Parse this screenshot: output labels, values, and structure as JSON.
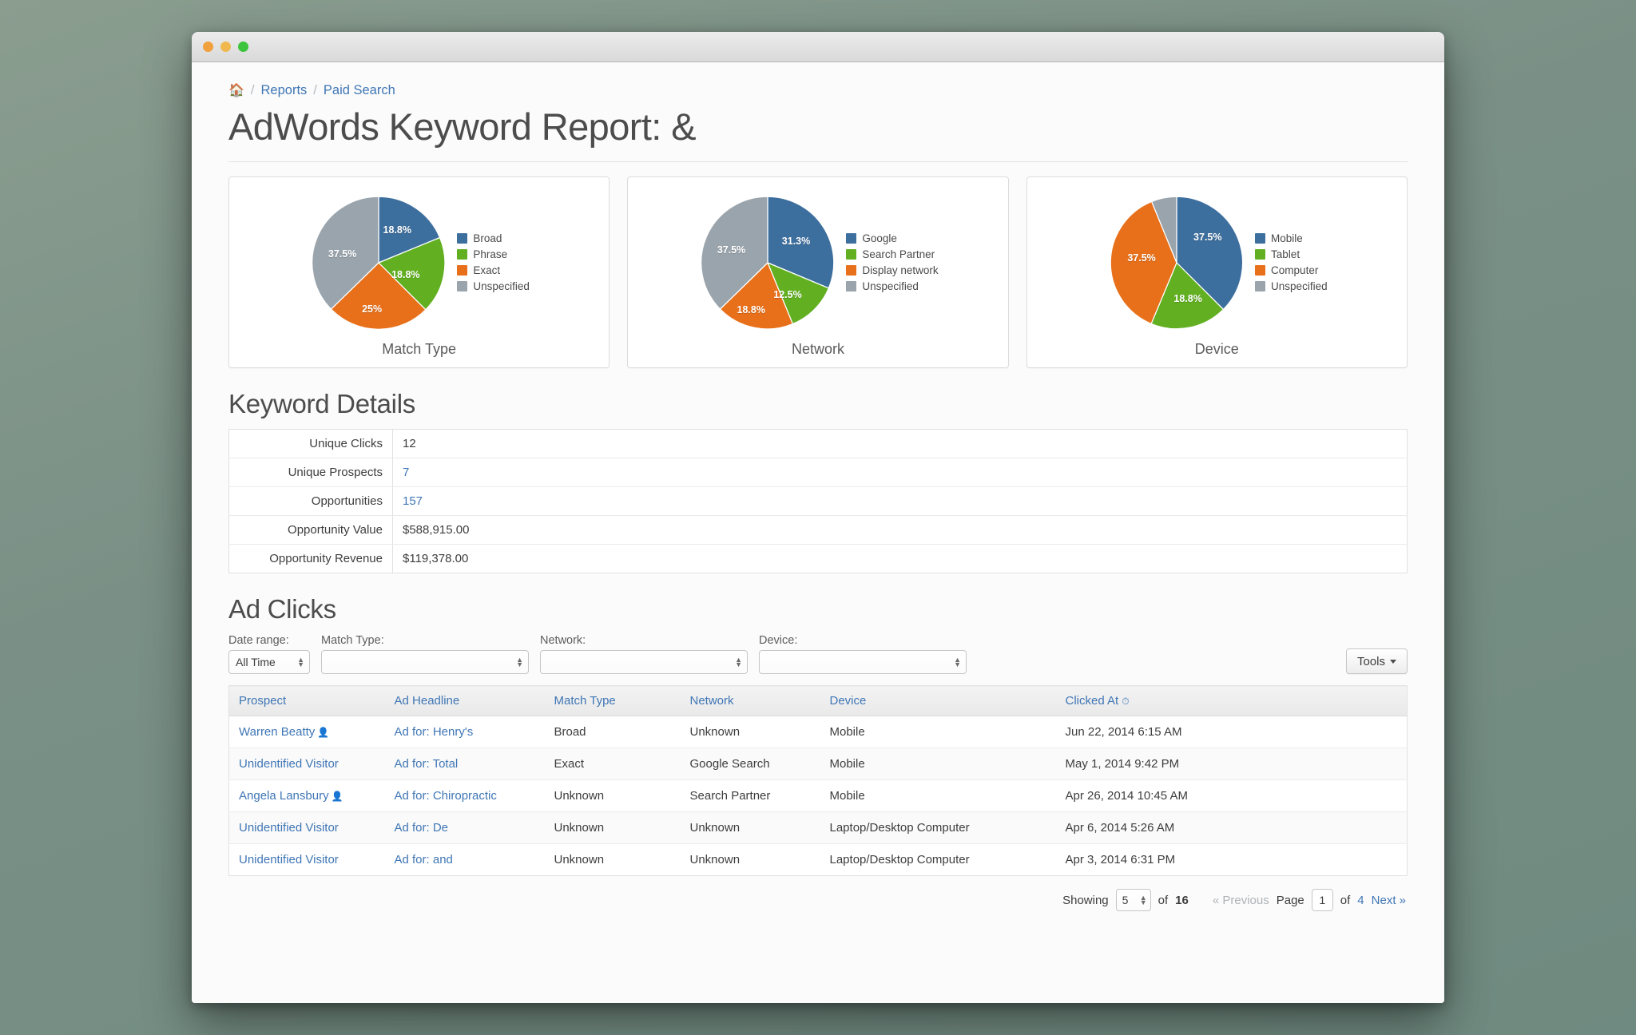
{
  "window": {
    "traffic_lights": [
      "close",
      "minimize",
      "zoom"
    ]
  },
  "breadcrumb": {
    "home_icon": "home-icon",
    "items": [
      "Reports",
      "Paid Search"
    ],
    "separator": "/"
  },
  "header": {
    "title": "AdWords Keyword Report: &"
  },
  "chart_data": [
    {
      "type": "pie",
      "title": "Match Type",
      "categories": [
        "Broad",
        "Phrase",
        "Exact",
        "Unspecified"
      ],
      "values": [
        18.8,
        18.8,
        25,
        37.5
      ],
      "labels": [
        "18.8%",
        "18.8%",
        "25%",
        "37.5%"
      ],
      "colors": [
        "#3d6f9e",
        "#62b022",
        "#e8701a",
        "#9aa4ac"
      ],
      "legend_position": "right",
      "unit": "%"
    },
    {
      "type": "pie",
      "title": "Network",
      "categories": [
        "Google",
        "Search Partner",
        "Display network",
        "Unspecified"
      ],
      "values": [
        31.3,
        12.5,
        18.8,
        37.5
      ],
      "labels": [
        "31.3%",
        "12.5%",
        "18.8%",
        "37.5%"
      ],
      "colors": [
        "#3d6f9e",
        "#62b022",
        "#e8701a",
        "#9aa4ac"
      ],
      "legend_position": "right",
      "unit": "%"
    },
    {
      "type": "pie",
      "title": "Device",
      "categories": [
        "Mobile",
        "Tablet",
        "Computer",
        "Unspecified"
      ],
      "values": [
        37.5,
        18.8,
        37.5,
        6.2
      ],
      "labels": [
        "37.5%",
        "18.8%",
        "37.5%",
        ""
      ],
      "colors": [
        "#3d6f9e",
        "#62b022",
        "#e8701a",
        "#9aa4ac"
      ],
      "legend_position": "right",
      "unit": "%"
    }
  ],
  "keyword_details": {
    "heading": "Keyword Details",
    "rows": [
      {
        "label": "Unique Clicks",
        "value": "12",
        "link": false
      },
      {
        "label": "Unique Prospects",
        "value": "7",
        "link": true
      },
      {
        "label": "Opportunities",
        "value": "157",
        "link": true
      },
      {
        "label": "Opportunity Value",
        "value": "$588,915.00",
        "link": false
      },
      {
        "label": "Opportunity Revenue",
        "value": "$119,378.00",
        "link": false
      }
    ]
  },
  "ad_clicks": {
    "heading": "Ad Clicks",
    "filters": {
      "date_range": {
        "label": "Date range:",
        "value": "All Time"
      },
      "match_type": {
        "label": "Match Type:",
        "value": ""
      },
      "network": {
        "label": "Network:",
        "value": ""
      },
      "device": {
        "label": "Device:",
        "value": ""
      }
    },
    "tools_button": "Tools",
    "columns": [
      "Prospect",
      "Ad Headline",
      "Match Type",
      "Network",
      "Device",
      "Clicked At"
    ],
    "sorted_column": "Clicked At",
    "rows": [
      {
        "prospect": "Warren Beatty",
        "has_person_icon": true,
        "ad_headline": "Ad for: Henry's",
        "match_type": "Broad",
        "network": "Unknown",
        "device": "Mobile",
        "clicked_at": "Jun 22, 2014 6:15 AM"
      },
      {
        "prospect": "Unidentified Visitor",
        "has_person_icon": false,
        "ad_headline": "Ad for: Total",
        "match_type": "Exact",
        "network": "Google Search",
        "device": "Mobile",
        "clicked_at": "May 1, 2014 9:42 PM"
      },
      {
        "prospect": "Angela Lansbury",
        "has_person_icon": true,
        "ad_headline": "Ad for: Chiropractic",
        "match_type": "Unknown",
        "network": "Search Partner",
        "device": "Mobile",
        "clicked_at": "Apr 26, 2014 10:45 AM"
      },
      {
        "prospect": "Unidentified Visitor",
        "has_person_icon": false,
        "ad_headline": "Ad for: De",
        "match_type": "Unknown",
        "network": "Unknown",
        "device": "Laptop/Desktop Computer",
        "clicked_at": "Apr 6, 2014 5:26 AM"
      },
      {
        "prospect": "Unidentified Visitor",
        "has_person_icon": false,
        "ad_headline": "Ad for: and",
        "match_type": "Unknown",
        "network": "Unknown",
        "device": "Laptop/Desktop Computer",
        "clicked_at": "Apr 3, 2014 6:31 PM"
      }
    ],
    "pagination": {
      "showing_label": "Showing",
      "per_page": "5",
      "of_label": "of",
      "total": "16",
      "previous": "« Previous",
      "page_label": "Page",
      "current_page": "1",
      "of_pages_label": "of",
      "total_pages": "4",
      "next": "Next »"
    }
  },
  "theme": {
    "link_color": "#3f76b5",
    "series_blue": "#3d6f9e",
    "series_green": "#62b022",
    "series_orange": "#e8701a",
    "series_gray": "#9aa4ac"
  }
}
